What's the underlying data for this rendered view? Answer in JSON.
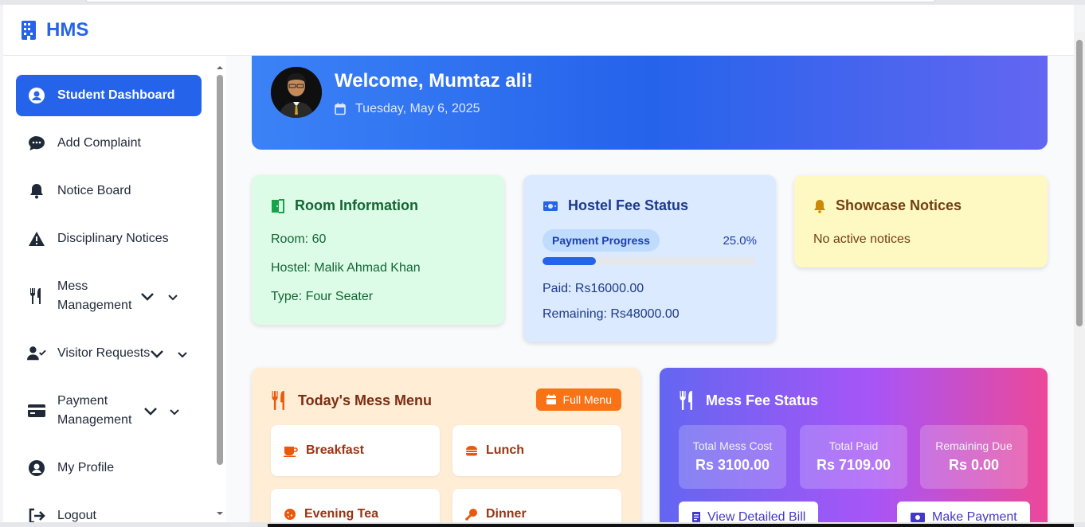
{
  "app": {
    "brand": "HMS"
  },
  "sidebar": {
    "items": [
      {
        "label": "Student Dashboard",
        "icon": "user-circle-icon",
        "active": true
      },
      {
        "label": "Add Complaint",
        "icon": "chat-icon"
      },
      {
        "label": "Notice Board",
        "icon": "bell-icon"
      },
      {
        "label": "Disciplinary Notices",
        "icon": "warning-icon"
      },
      {
        "label": "Mess Management",
        "icon": "utensils-icon",
        "expandable": true
      },
      {
        "label": "Visitor Requests",
        "icon": "user-check-icon",
        "expandable": true
      },
      {
        "label": "Payment Management",
        "icon": "credit-card-icon",
        "expandable": true
      },
      {
        "label": "My Profile",
        "icon": "user-circle-icon"
      },
      {
        "label": "Logout",
        "icon": "logout-icon"
      }
    ]
  },
  "hero": {
    "welcome": "Welcome, Mumtaz ali!",
    "date": "Tuesday, May 6, 2025"
  },
  "room": {
    "title": "Room Information",
    "room": "Room: 60",
    "hostel": "Hostel: Malik Ahmad Khan",
    "type": "Type: Four Seater"
  },
  "fee": {
    "title": "Hostel Fee Status",
    "progress_label": "Payment Progress",
    "progress_text": "25.0%",
    "progress_value": 0.25,
    "paid": "Paid: Rs16000.00",
    "remaining": "Remaining: Rs48000.00"
  },
  "notices": {
    "title": "Showcase Notices",
    "empty": "No active notices"
  },
  "mess_menu": {
    "title": "Today's Mess Menu",
    "full_menu": "Full Menu",
    "meals": [
      "Breakfast",
      "Lunch",
      "Evening Tea",
      "Dinner"
    ]
  },
  "mess_fee": {
    "title": "Mess Fee Status",
    "total_cost_label": "Total Mess Cost",
    "total_cost": "Rs 3100.00",
    "total_paid_label": "Total Paid",
    "total_paid": "Rs 7109.00",
    "remaining_label": "Remaining Due",
    "remaining": "Rs 0.00",
    "bill_button": "View Detailed Bill",
    "pay_button": "Make Payment"
  },
  "colors": {
    "primary": "#2563eb",
    "room_card": "#dcfce7",
    "fee_card": "#dbeafe",
    "notice_card": "#fef9c3",
    "menu_card": "#ffedd5"
  }
}
